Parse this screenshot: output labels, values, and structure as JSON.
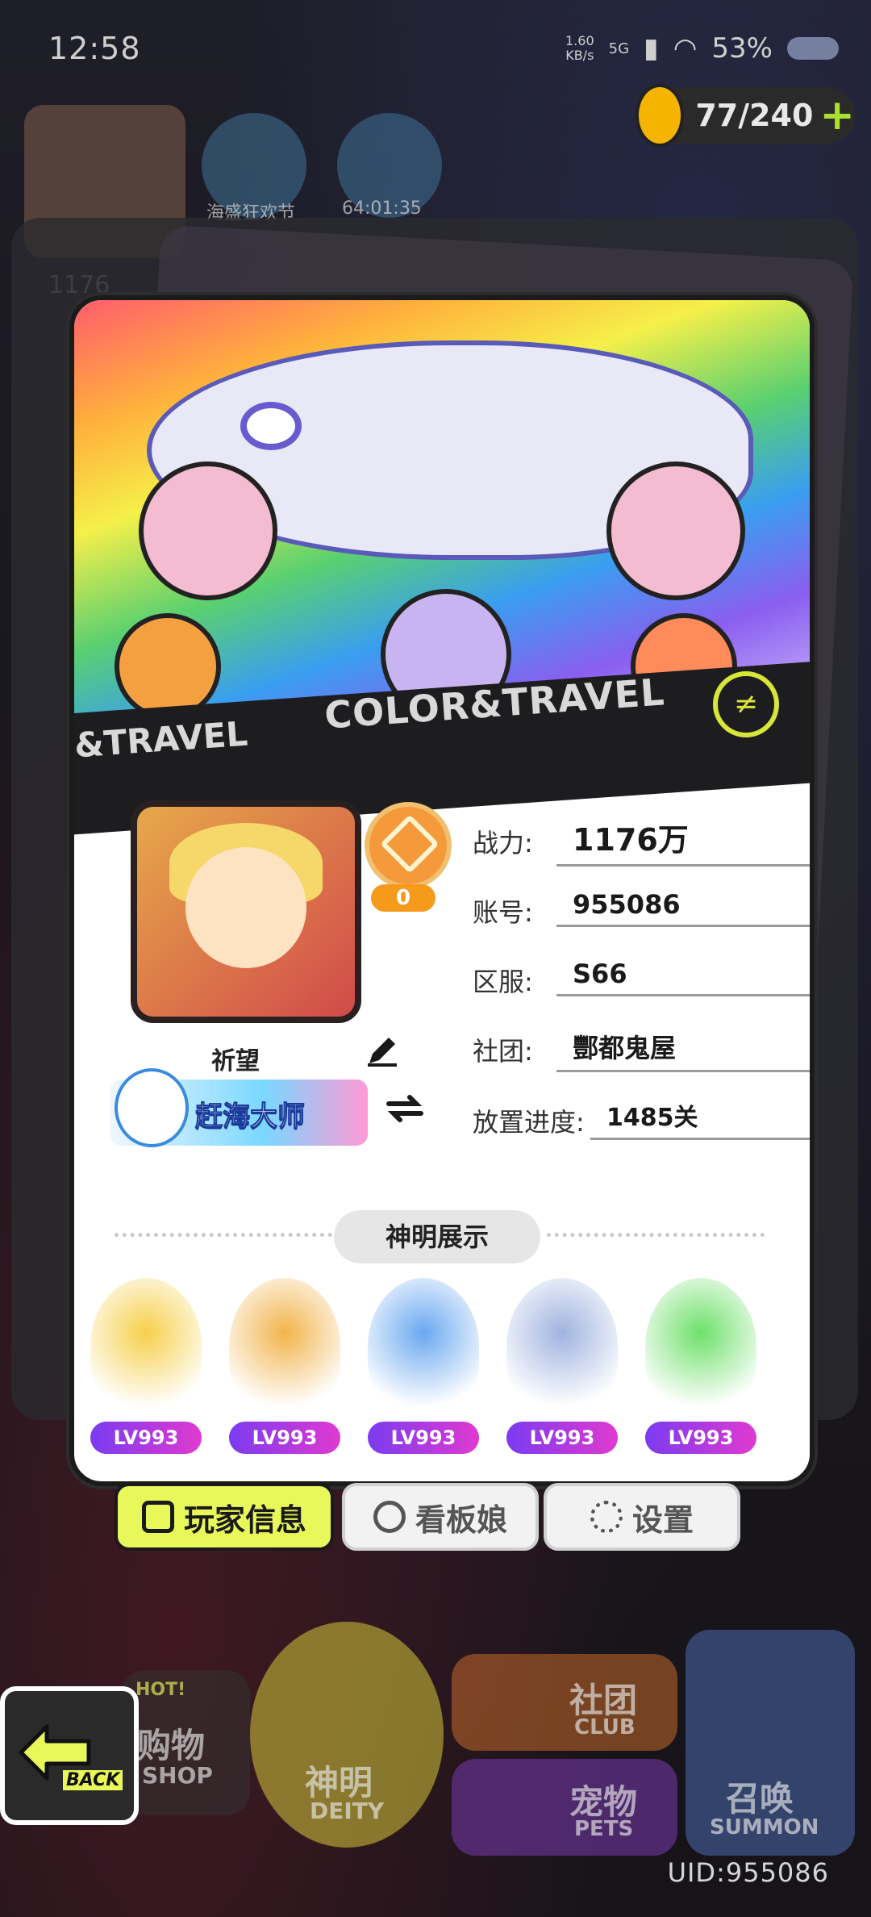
{
  "status_bar": {
    "time": "12:58",
    "net_speed_value": "1.60",
    "net_speed_unit": "KB/s",
    "network": "5G",
    "battery": "53%"
  },
  "hud": {
    "energy": "77/240",
    "event1_label": "海盛狂欢节",
    "event2_timer": "64:01:35",
    "power_partial": "1176"
  },
  "card": {
    "banner_text": "COLOR&TRAVEL",
    "banner_text_left": "&TRAVEL",
    "banner_logo": "≠",
    "rank_value": "0",
    "player_name": "祈望",
    "player_title": "赶海大师",
    "fields": [
      {
        "label": "战力:",
        "value": "1176万"
      },
      {
        "label": "账号:",
        "value": "955086"
      },
      {
        "label": "区服:",
        "value": "S66"
      },
      {
        "label": "社团:",
        "value": "酆都鬼屋"
      },
      {
        "label": "放置进度:",
        "value": "1485关"
      }
    ],
    "deity_title": "神明展示",
    "deities": [
      {
        "level": "LV993",
        "color": "#f6d04a"
      },
      {
        "level": "LV993",
        "color": "#f2b44c"
      },
      {
        "level": "LV993",
        "color": "#6aa8f0"
      },
      {
        "level": "LV993",
        "color": "#a0b4e0"
      },
      {
        "level": "LV993",
        "color": "#6ee06a"
      }
    ]
  },
  "tabs": {
    "player_info": "玩家信息",
    "mascot": "看板娘",
    "settings": "设置"
  },
  "bottom": {
    "back": "BACK",
    "shop": "购物",
    "shop_en": "SHOP",
    "hot": "HOT!",
    "deity": "神明",
    "deity_en": "DEITY",
    "club": "社团",
    "club_en": "CLUB",
    "pets": "宠物",
    "pets_en": "PETS",
    "summon": "召唤",
    "summon_en": "SUMMON",
    "uid": "UID:955086"
  }
}
